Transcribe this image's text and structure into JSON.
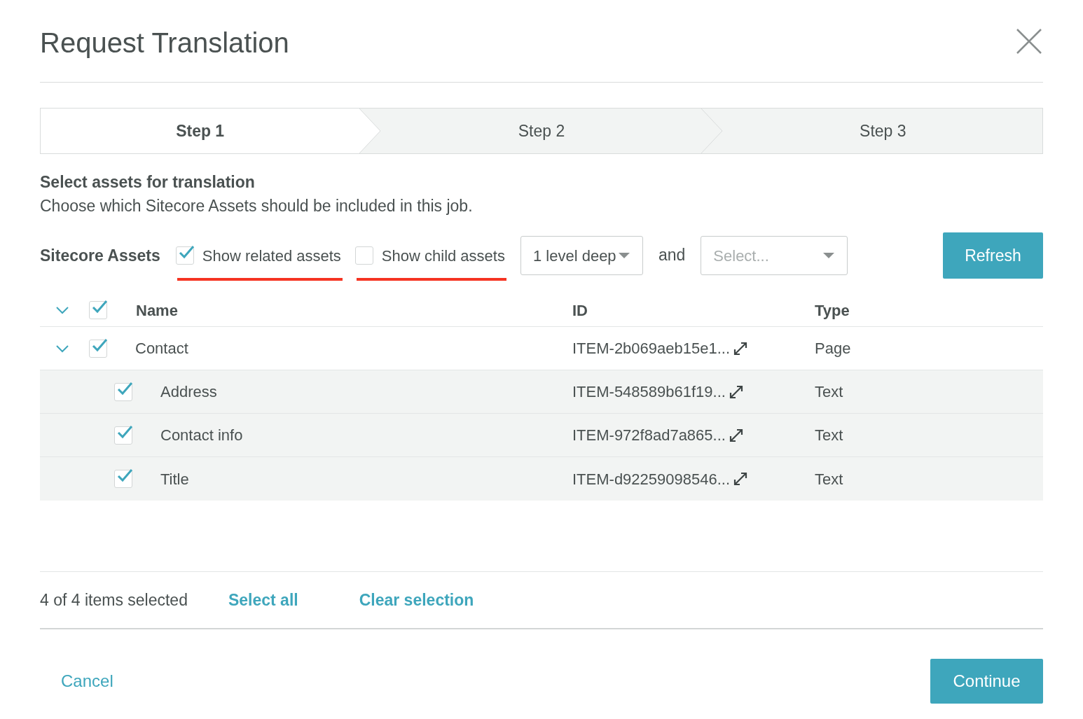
{
  "dialog": {
    "title": "Request Translation"
  },
  "steps": [
    {
      "label": "Step 1",
      "selected": true
    },
    {
      "label": "Step 2",
      "selected": false
    },
    {
      "label": "Step 3",
      "selected": false
    }
  ],
  "section": {
    "heading": "Select assets for translation",
    "description": "Choose which Sitecore Assets should be included in this job."
  },
  "toolbar": {
    "label": "Sitecore Assets",
    "options": [
      {
        "label": "Show related assets",
        "checked": true,
        "underlined": true
      },
      {
        "label": "Show child assets",
        "checked": false,
        "underlined": true
      }
    ],
    "depth": {
      "value": "1 level deep"
    },
    "conjunction": "and",
    "filter": {
      "placeholder": "Select..."
    },
    "refresh": "Refresh"
  },
  "table": {
    "expanded": true,
    "checked": true,
    "columns": [
      "Name",
      "ID",
      "Type"
    ],
    "rows": [
      {
        "name": "Contact",
        "id": "ITEM-2b069aeb15e1...",
        "type": "Page",
        "checked": true,
        "expanded": true,
        "children": [
          {
            "name": "Address",
            "id": "ITEM-548589b61f19...",
            "type": "Text",
            "checked": true
          },
          {
            "name": "Contact info",
            "id": "ITEM-972f8ad7a865...",
            "type": "Text",
            "checked": true
          },
          {
            "name": "Title",
            "id": "ITEM-d92259098546...",
            "type": "Text",
            "checked": true
          }
        ]
      }
    ]
  },
  "footer": {
    "summary": "4 of 4 items selected",
    "select_all": "Select all",
    "clear_selection": "Clear selection"
  },
  "actions": {
    "cancel": "Cancel",
    "continue": "Continue"
  }
}
